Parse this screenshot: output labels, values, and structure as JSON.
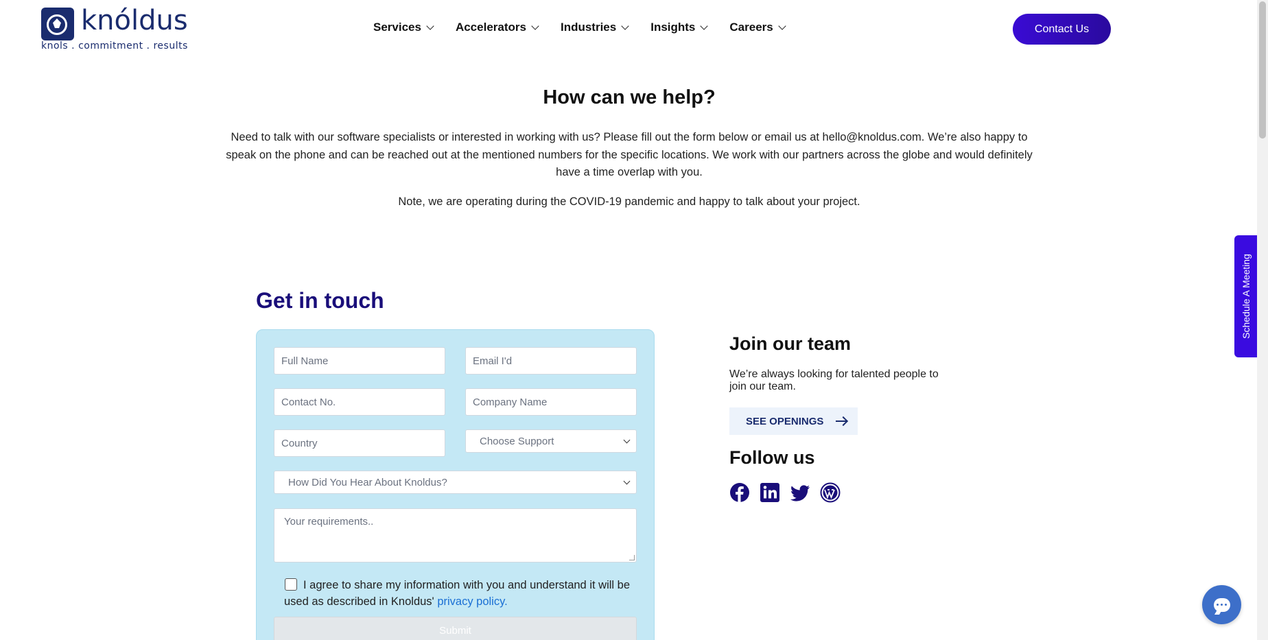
{
  "header": {
    "logo_word": "knóldus",
    "logo_tagline": "knols . commitment . results",
    "nav": [
      {
        "label": "Services"
      },
      {
        "label": "Accelerators"
      },
      {
        "label": "Industries"
      },
      {
        "label": "Insights"
      },
      {
        "label": "Careers"
      }
    ],
    "contact_label": "Contact Us"
  },
  "intro": {
    "title": "How can we help?",
    "text": "Need to talk with our software specialists or interested in working with us? Please fill out the form below or email us at hello@knoldus.com. We’re also happy to speak on the phone and can be reached out at the mentioned numbers for the specific locations. We work with our partners across the globe and would definitely have a time overlap with you.",
    "note": "Note, we are operating during the COVID-19 pandemic and happy to talk about your project."
  },
  "form": {
    "title": "Get in touch",
    "full_name_placeholder": "Full Name",
    "email_placeholder": "Email I'd",
    "contact_placeholder": "Contact No.",
    "company_placeholder": "Company Name",
    "country_placeholder": "Country",
    "support_select": "Choose Support",
    "hear_select": "How Did You Hear About Knoldus?",
    "requirements_placeholder": "Your requirements..",
    "consent_text": "I agree to share my information with you and understand it will be used as described in Knoldus'",
    "privacy_link": "privacy policy.",
    "submit_label": "Submit"
  },
  "join": {
    "title": "Join our team",
    "text": "We’re always looking for talented people to join our team.",
    "openings_label": "SEE OPENINGS"
  },
  "follow": {
    "title": "Follow us",
    "icons": [
      "facebook-icon",
      "linkedin-icon",
      "twitter-icon",
      "wordpress-icon"
    ]
  },
  "side_tab": {
    "label": "Schedule A Meeting"
  },
  "colors": {
    "brand": "#1a2c6e",
    "accent": "#3a0bd4",
    "form_bg": "#c4e8f5",
    "heading_accent": "#1a0e7a"
  }
}
